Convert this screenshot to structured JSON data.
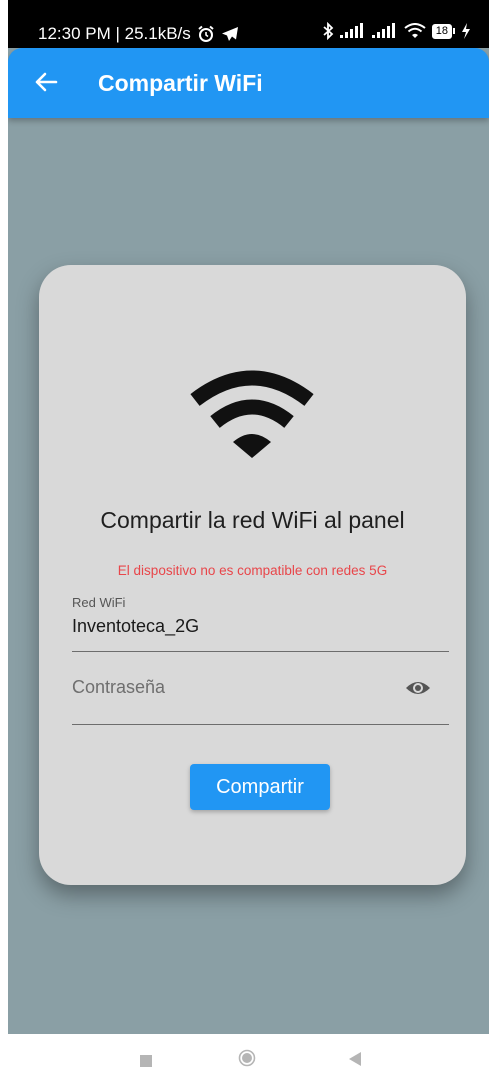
{
  "status_bar": {
    "time_speed": "12:30 PM | 25.1kB/s",
    "battery": "18"
  },
  "app_bar": {
    "title": "Compartir WiFi"
  },
  "card": {
    "title": "Compartir la red WiFi al panel",
    "warning": "El dispositivo no es compatible con redes 5G",
    "network_field": {
      "label": "Red WiFi",
      "value": "Inventoteca_2G"
    },
    "password_field": {
      "placeholder": "Contraseña",
      "value": ""
    },
    "share_button_label": "Compartir"
  },
  "colors": {
    "primary": "#2196f3",
    "background": "#8a9fa5",
    "card": "#d9d9d9",
    "warning": "#e8464a"
  }
}
